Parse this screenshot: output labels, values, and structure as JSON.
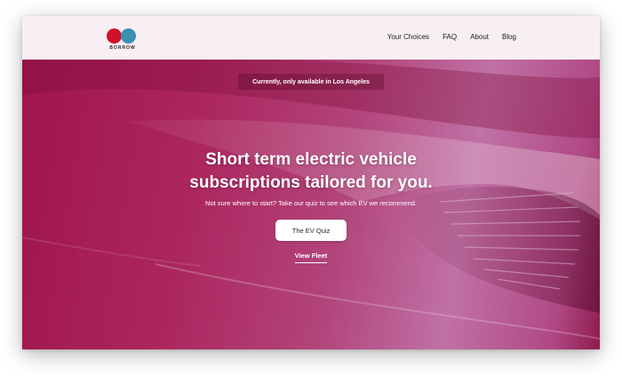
{
  "brand": {
    "logo_text": "BORROW"
  },
  "nav": {
    "items": [
      "Your Choices",
      "FAQ",
      "About",
      "Blog"
    ]
  },
  "hero": {
    "banner": "Currently, only available in Los Angeles",
    "headline_line1": "Short term electric vehicle",
    "headline_line2": "subscriptions tailored for you.",
    "subtext": "Not sure where to start? Take our quiz to see which EV we recommend.",
    "cta_label": "The EV Quiz",
    "secondary_link": "View Fleet"
  },
  "colors": {
    "accent_red": "#d0102f",
    "accent_blue": "#3b8fb0",
    "hero_magenta": "#a3164d",
    "hero_lilac": "#c77fb3"
  }
}
